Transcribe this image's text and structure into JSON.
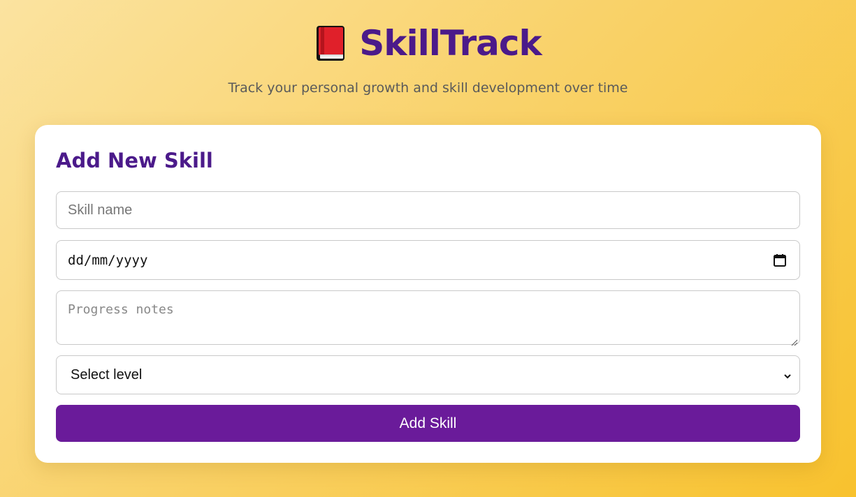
{
  "header": {
    "app_title": "SkillTrack",
    "subtitle": "Track your personal growth and skill development over time",
    "logo_icon": "red-book-icon"
  },
  "form": {
    "title": "Add New Skill",
    "skill_name_placeholder": "Skill name",
    "date_placeholder": "dd/mm/yyyy",
    "notes_placeholder": "Progress notes",
    "level_selected": "Select level",
    "submit_label": "Add Skill"
  },
  "colors": {
    "accent": "#4b1a8a",
    "button": "#6a1b9a",
    "background_start": "#fbe3a0",
    "background_end": "#f8c22e"
  }
}
